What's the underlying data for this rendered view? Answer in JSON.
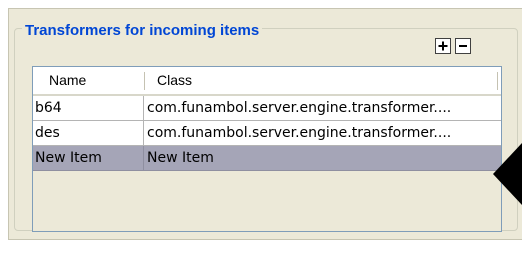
{
  "panel": {
    "title": "Transformers for incoming items",
    "add_icon": "plus-square-icon",
    "remove_icon": "minus-square-icon"
  },
  "table": {
    "columns": [
      "Name",
      "Class"
    ],
    "rows": [
      {
        "name": "b64",
        "class": "com.funambol.server.engine.transformer...."
      },
      {
        "name": "des",
        "class": "com.funambol.server.engine.transformer...."
      },
      {
        "name": "New Item",
        "class": "New Item",
        "selected": true
      }
    ]
  },
  "colors": {
    "title": "#0046d5",
    "panel_background": "#ece9d8",
    "selected_row": "#a5a5b7",
    "table_border": "#7f9db9"
  },
  "pointer_icon": "left-arrow-pointer-icon"
}
